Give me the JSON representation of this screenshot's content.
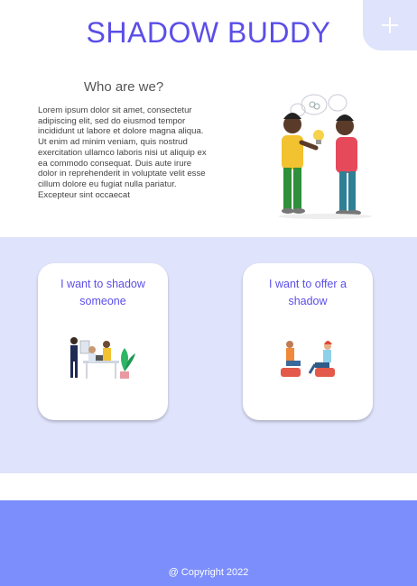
{
  "header": {
    "title": "SHADOW BUDDY",
    "corner_icon": "plus-icon"
  },
  "about": {
    "heading": "Who are we?",
    "body": "Lorem ipsum dolor sit amet, consectetur adipiscing elit, sed do eiusmod tempor incididunt ut labore et dolore magna aliqua. Ut enim ad minim veniam, quis nostrud exercitation ullamco laboris nisi ut aliquip ex ea commodo consequat. Duis aute irure dolor in reprehenderit in voluptate velit esse cillum dolore eu fugiat nulla pariatur. Excepteur sint occaecat"
  },
  "cards": [
    {
      "label": "I want to shadow someone"
    },
    {
      "label": "I want to offer a shadow"
    }
  ],
  "footer": {
    "copyright": "@ Copyright 2022"
  },
  "colors": {
    "accent": "#5b4ee8",
    "band": "#dfe3fb",
    "footer": "#7b8efb"
  }
}
